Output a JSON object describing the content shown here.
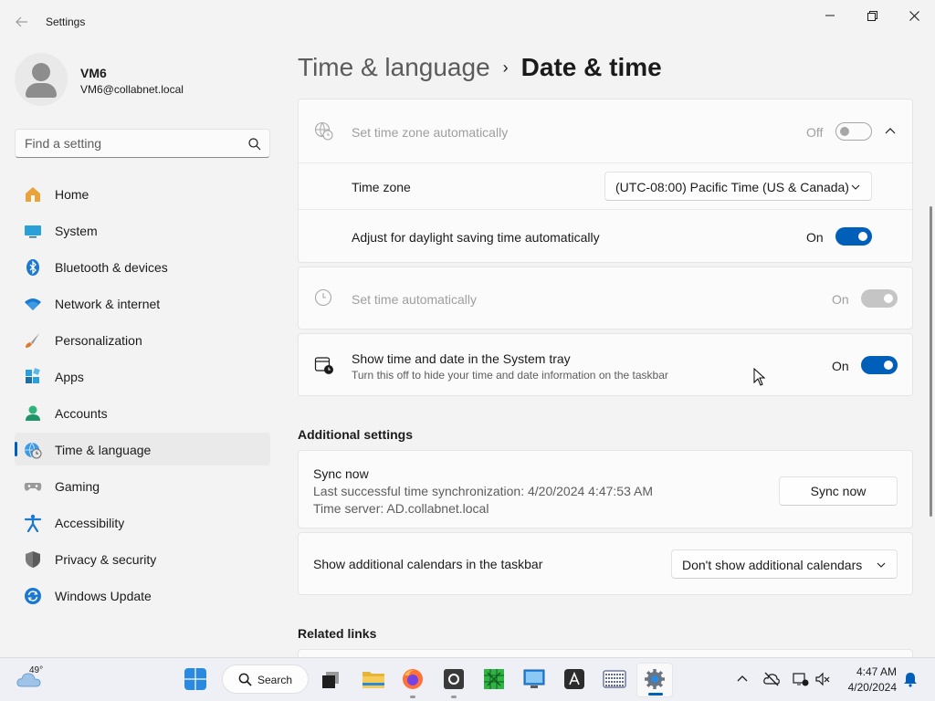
{
  "window": {
    "title": "Settings"
  },
  "profile": {
    "name": "VM6",
    "email": "VM6@collabnet.local"
  },
  "search": {
    "placeholder": "Find a setting"
  },
  "nav": {
    "items": [
      {
        "label": "Home",
        "icon": "home-icon"
      },
      {
        "label": "System",
        "icon": "system-icon"
      },
      {
        "label": "Bluetooth & devices",
        "icon": "bluetooth-icon"
      },
      {
        "label": "Network & internet",
        "icon": "wifi-icon"
      },
      {
        "label": "Personalization",
        "icon": "brush-icon"
      },
      {
        "label": "Apps",
        "icon": "apps-icon"
      },
      {
        "label": "Accounts",
        "icon": "accounts-icon"
      },
      {
        "label": "Time & language",
        "icon": "globe-clock-icon",
        "active": true
      },
      {
        "label": "Gaming",
        "icon": "gamepad-icon"
      },
      {
        "label": "Accessibility",
        "icon": "accessibility-icon"
      },
      {
        "label": "Privacy & security",
        "icon": "shield-icon"
      },
      {
        "label": "Windows Update",
        "icon": "update-icon"
      }
    ]
  },
  "breadcrumb": {
    "parent": "Time & language",
    "separator": "›",
    "current": "Date & time"
  },
  "timezone_card": {
    "auto_tz_label": "Set time zone automatically",
    "auto_tz_state": "Off",
    "tz_label": "Time zone",
    "tz_value": "(UTC-08:00) Pacific Time (US & Canada)",
    "dst_label": "Adjust for daylight saving time automatically",
    "dst_state": "On"
  },
  "auto_time": {
    "label": "Set time automatically",
    "state": "On"
  },
  "tray": {
    "label": "Show time and date in the System tray",
    "description": "Turn this off to hide your time and date information on the taskbar",
    "state": "On"
  },
  "additional": {
    "heading": "Additional settings",
    "sync_title": "Sync now",
    "last_sync": "Last successful time synchronization: 4/20/2024 4:47:53 AM",
    "time_server": "Time server: AD.collabnet.local",
    "sync_button": "Sync now",
    "calendars_label": "Show additional calendars in the taskbar",
    "calendars_value": "Don't show additional calendars"
  },
  "related": {
    "heading": "Related links"
  },
  "taskbar": {
    "temperature": "49°",
    "search_label": "Search",
    "time": "4:47 AM",
    "date": "4/20/2024",
    "apps": [
      "start-icon",
      "task-view-icon",
      "file-explorer-icon",
      "firefox-icon",
      "outlook-icon",
      "spreadsheet-icon",
      "remote-desktop-icon",
      "font-app-icon",
      "keyboard-app-icon",
      "settings-icon"
    ]
  },
  "colors": {
    "accent": "#005fb8",
    "background": "#f3f3f3",
    "card": "#fbfbfb"
  }
}
